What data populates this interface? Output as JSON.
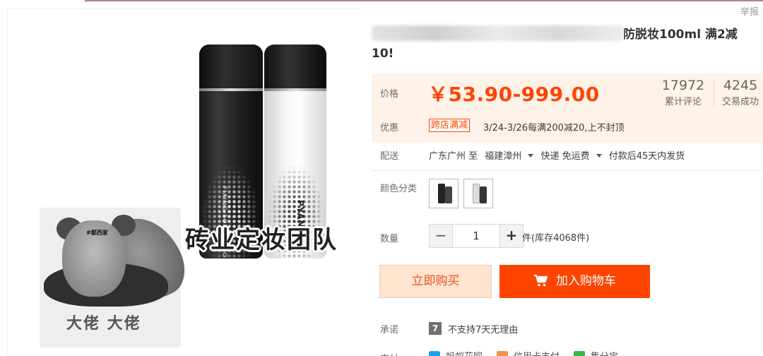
{
  "report_label": "举报",
  "gallery": {
    "caption": "砖业定妆团队",
    "meme": {
      "tag": "#都西家",
      "text": "大佬 大佬"
    },
    "bottle_black_text": "FIXING FOUNDATION SPRAY",
    "bottle_white_text": "PYAMY"
  },
  "title": {
    "visible_text": "防脱妆100ml 满2减10!"
  },
  "price": {
    "label": "价格",
    "value": "￥53.90-999.00",
    "reviews_count": "17972",
    "reviews_label": "累计评论",
    "deals_count": "4245",
    "deals_label": "交易成功"
  },
  "promo": {
    "label": "优惠",
    "tag": "跨店满减",
    "text": "3/24-3/26每满200减20,上不封顶"
  },
  "shipping": {
    "label": "配送",
    "from": "广东广州 至",
    "to": "福建漳州",
    "method": "快递 免运费",
    "delivery": "付款后45天内发货"
  },
  "color": {
    "label": "颜色分类"
  },
  "quantity": {
    "label": "数量",
    "value": "1",
    "minus": "−",
    "plus": "+",
    "stock": "件(库存4068件)"
  },
  "actions": {
    "buy_now": "立即购买",
    "add_cart": "加入购物车"
  },
  "promise": {
    "label": "承诺",
    "badge": "7",
    "text": "不支持7天无理由"
  },
  "payment": {
    "label": "支付",
    "items": [
      "蚂蚁花呗",
      "信用卡支付",
      "集分宝"
    ]
  },
  "colors": {
    "accent": "#ff4400",
    "price_bg": "#fff2e8",
    "buy_now_bg": "#ffe4d0"
  }
}
